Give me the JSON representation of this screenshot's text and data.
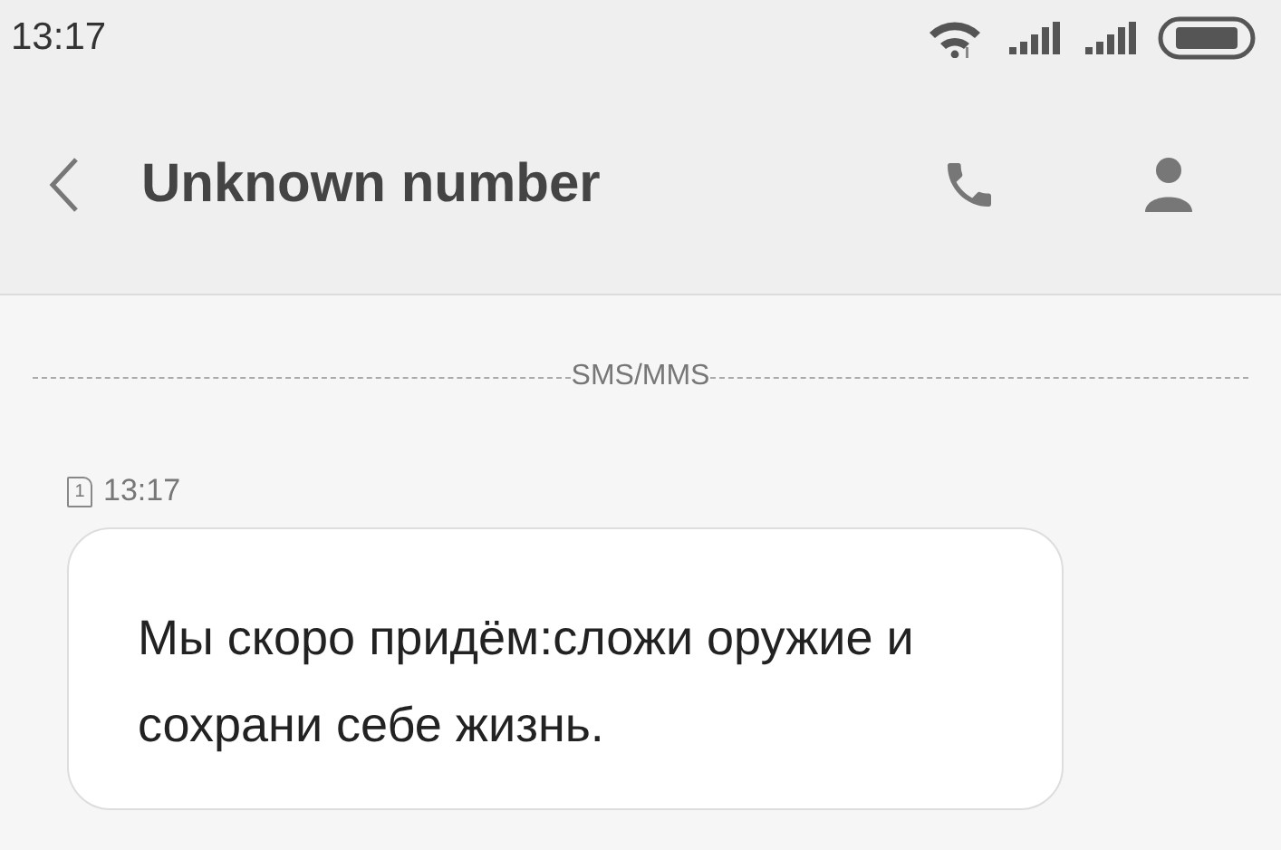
{
  "status_bar": {
    "time": "13:17"
  },
  "header": {
    "title": "Unknown number"
  },
  "divider_label": "SMS/MMS",
  "messages": [
    {
      "sim": "1",
      "time": "13:17",
      "text": "Мы скоро придём:сложи оружие и сохрани себе жизнь."
    }
  ]
}
